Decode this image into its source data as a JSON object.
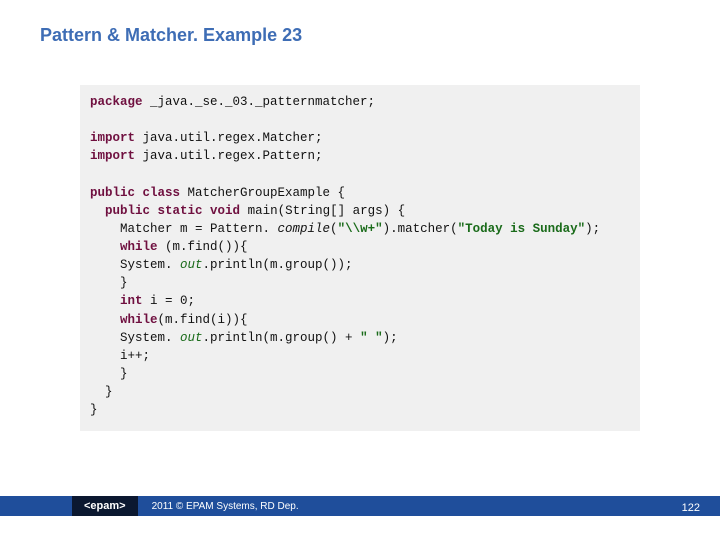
{
  "title": "Pattern & Matcher. Example 23",
  "code": {
    "kw_package": "package",
    "pkg": " _java._se._03._patternmatcher;",
    "kw_import1": "import",
    "imp1": " java.util.regex.Matcher;",
    "kw_import2": "import",
    "imp2": " java.util.regex.Pattern;",
    "kw_public": "public",
    "kw_class": " class",
    "classname": " MatcherGroupExample {",
    "kw_pub2": "public",
    "kw_static": " static",
    "kw_void": " void",
    "main_sig": " main(String[] args) {",
    "mline_a": "    Matcher m = Pattern.",
    "compile": " compile",
    "mline_b": "(",
    "str_regex": "\"\\\\w+\"",
    "mline_c": ").matcher(",
    "str_today": "\"Today is Sunday\"",
    "mline_d": ");",
    "kw_while1": "while",
    "while1_tail": " (m.find()){",
    "sys1_a": "    System.",
    "out1": " out",
    "sys1_b": ".println(m.group());",
    "brace1": "    }",
    "kw_int": "int",
    "int_tail": " i = 0;",
    "kw_while2": "while",
    "while2_tail": "(m.find(i)){",
    "sys2_a": "    System.",
    "out2": " out",
    "sys2_b": ".println(m.group() + ",
    "str_space": "\" \"",
    "sys2_c": ");",
    "ipp": "    i++;",
    "brace2": "    }",
    "brace3": "  }",
    "brace4": "}"
  },
  "footer": {
    "logo": "<epam>",
    "copy": "2011 © EPAM Systems, RD Dep.",
    "page": "122"
  }
}
